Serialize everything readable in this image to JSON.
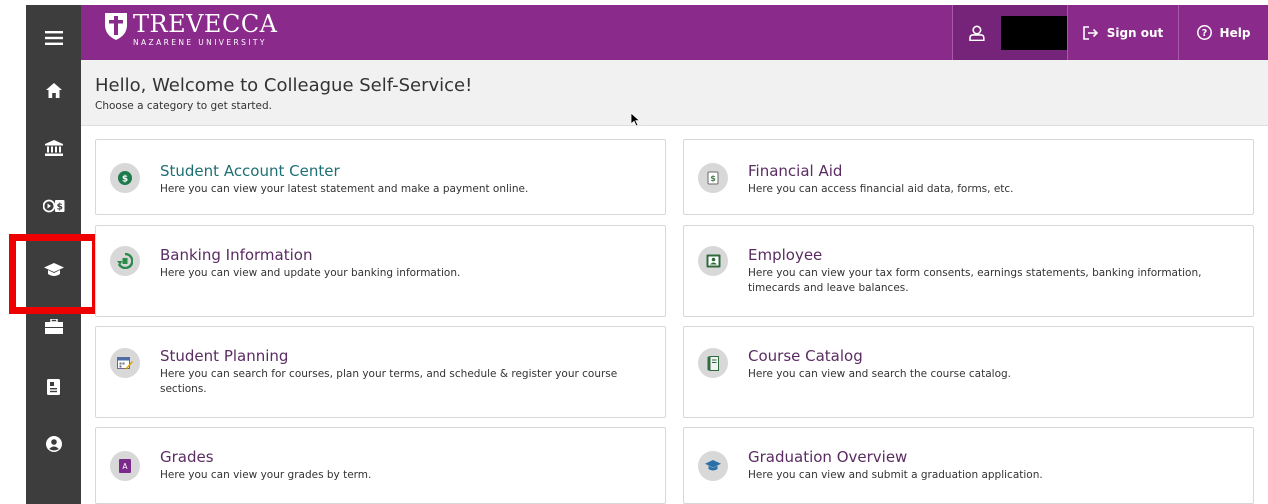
{
  "logo": {
    "main": "TREVECCA",
    "sub": "NAZARENE UNIVERSITY"
  },
  "topbar": {
    "signout_label": "Sign out",
    "help_label": "Help"
  },
  "welcome": {
    "title": "Hello, Welcome to Colleague Self-Service!",
    "subtitle": "Choose a category to get started."
  },
  "sidebar": {
    "items": [
      {
        "icon": "menu-icon"
      },
      {
        "icon": "home-icon"
      },
      {
        "icon": "bank-icon"
      },
      {
        "icon": "finance-icon"
      },
      {
        "icon": "graduation-cap-icon"
      },
      {
        "icon": "briefcase-icon"
      },
      {
        "icon": "document-icon"
      },
      {
        "icon": "user-circle-icon"
      }
    ]
  },
  "cards": [
    {
      "title": "Student Account Center",
      "desc": "Here you can view your latest statement and make a payment online.",
      "icon": "dollar-icon"
    },
    {
      "title": "Financial Aid",
      "desc": "Here you can access financial aid data, forms, etc.",
      "icon": "money-icon"
    },
    {
      "title": "Banking Information",
      "desc": "Here you can view and update your banking information.",
      "icon": "bank-refresh-icon"
    },
    {
      "title": "Employee",
      "desc": "Here you can view your tax form consents, earnings statements, banking information, timecards and leave balances.",
      "icon": "id-badge-icon"
    },
    {
      "title": "Student Planning",
      "desc": "Here you can search for courses, plan your terms, and schedule & register your course sections.",
      "icon": "calendar-pencil-icon"
    },
    {
      "title": "Course Catalog",
      "desc": "Here you can view and search the course catalog.",
      "icon": "book-icon"
    },
    {
      "title": "Grades",
      "desc": "Here you can view your grades by term.",
      "icon": "grade-icon"
    },
    {
      "title": "Graduation Overview",
      "desc": "Here you can view and submit a graduation application.",
      "icon": "graduation-icon"
    }
  ],
  "colors": {
    "brand": "#8a2a8b",
    "sidebar": "#3d3d3d",
    "highlight": "#ee0000",
    "title_teal": "#1e6f73",
    "title_purple": "#5a2c62"
  }
}
